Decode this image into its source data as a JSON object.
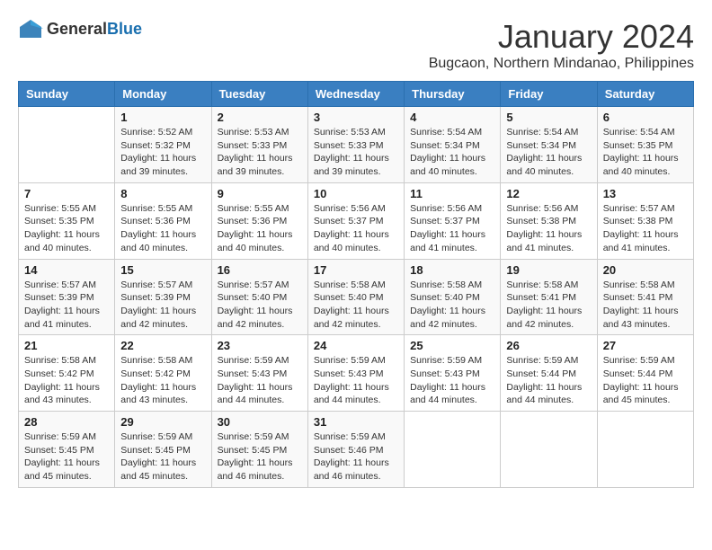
{
  "header": {
    "logo": {
      "general": "General",
      "blue": "Blue"
    },
    "title": "January 2024",
    "location": "Bugcaon, Northern Mindanao, Philippines"
  },
  "weekdays": [
    "Sunday",
    "Monday",
    "Tuesday",
    "Wednesday",
    "Thursday",
    "Friday",
    "Saturday"
  ],
  "weeks": [
    [
      {
        "day": "",
        "info": ""
      },
      {
        "day": "1",
        "info": "Sunrise: 5:52 AM\nSunset: 5:32 PM\nDaylight: 11 hours\nand 39 minutes."
      },
      {
        "day": "2",
        "info": "Sunrise: 5:53 AM\nSunset: 5:33 PM\nDaylight: 11 hours\nand 39 minutes."
      },
      {
        "day": "3",
        "info": "Sunrise: 5:53 AM\nSunset: 5:33 PM\nDaylight: 11 hours\nand 39 minutes."
      },
      {
        "day": "4",
        "info": "Sunrise: 5:54 AM\nSunset: 5:34 PM\nDaylight: 11 hours\nand 40 minutes."
      },
      {
        "day": "5",
        "info": "Sunrise: 5:54 AM\nSunset: 5:34 PM\nDaylight: 11 hours\nand 40 minutes."
      },
      {
        "day": "6",
        "info": "Sunrise: 5:54 AM\nSunset: 5:35 PM\nDaylight: 11 hours\nand 40 minutes."
      }
    ],
    [
      {
        "day": "7",
        "info": "Sunrise: 5:55 AM\nSunset: 5:35 PM\nDaylight: 11 hours\nand 40 minutes."
      },
      {
        "day": "8",
        "info": "Sunrise: 5:55 AM\nSunset: 5:36 PM\nDaylight: 11 hours\nand 40 minutes."
      },
      {
        "day": "9",
        "info": "Sunrise: 5:55 AM\nSunset: 5:36 PM\nDaylight: 11 hours\nand 40 minutes."
      },
      {
        "day": "10",
        "info": "Sunrise: 5:56 AM\nSunset: 5:37 PM\nDaylight: 11 hours\nand 40 minutes."
      },
      {
        "day": "11",
        "info": "Sunrise: 5:56 AM\nSunset: 5:37 PM\nDaylight: 11 hours\nand 41 minutes."
      },
      {
        "day": "12",
        "info": "Sunrise: 5:56 AM\nSunset: 5:38 PM\nDaylight: 11 hours\nand 41 minutes."
      },
      {
        "day": "13",
        "info": "Sunrise: 5:57 AM\nSunset: 5:38 PM\nDaylight: 11 hours\nand 41 minutes."
      }
    ],
    [
      {
        "day": "14",
        "info": "Sunrise: 5:57 AM\nSunset: 5:39 PM\nDaylight: 11 hours\nand 41 minutes."
      },
      {
        "day": "15",
        "info": "Sunrise: 5:57 AM\nSunset: 5:39 PM\nDaylight: 11 hours\nand 42 minutes."
      },
      {
        "day": "16",
        "info": "Sunrise: 5:57 AM\nSunset: 5:40 PM\nDaylight: 11 hours\nand 42 minutes."
      },
      {
        "day": "17",
        "info": "Sunrise: 5:58 AM\nSunset: 5:40 PM\nDaylight: 11 hours\nand 42 minutes."
      },
      {
        "day": "18",
        "info": "Sunrise: 5:58 AM\nSunset: 5:40 PM\nDaylight: 11 hours\nand 42 minutes."
      },
      {
        "day": "19",
        "info": "Sunrise: 5:58 AM\nSunset: 5:41 PM\nDaylight: 11 hours\nand 42 minutes."
      },
      {
        "day": "20",
        "info": "Sunrise: 5:58 AM\nSunset: 5:41 PM\nDaylight: 11 hours\nand 43 minutes."
      }
    ],
    [
      {
        "day": "21",
        "info": "Sunrise: 5:58 AM\nSunset: 5:42 PM\nDaylight: 11 hours\nand 43 minutes."
      },
      {
        "day": "22",
        "info": "Sunrise: 5:58 AM\nSunset: 5:42 PM\nDaylight: 11 hours\nand 43 minutes."
      },
      {
        "day": "23",
        "info": "Sunrise: 5:59 AM\nSunset: 5:43 PM\nDaylight: 11 hours\nand 44 minutes."
      },
      {
        "day": "24",
        "info": "Sunrise: 5:59 AM\nSunset: 5:43 PM\nDaylight: 11 hours\nand 44 minutes."
      },
      {
        "day": "25",
        "info": "Sunrise: 5:59 AM\nSunset: 5:43 PM\nDaylight: 11 hours\nand 44 minutes."
      },
      {
        "day": "26",
        "info": "Sunrise: 5:59 AM\nSunset: 5:44 PM\nDaylight: 11 hours\nand 44 minutes."
      },
      {
        "day": "27",
        "info": "Sunrise: 5:59 AM\nSunset: 5:44 PM\nDaylight: 11 hours\nand 45 minutes."
      }
    ],
    [
      {
        "day": "28",
        "info": "Sunrise: 5:59 AM\nSunset: 5:45 PM\nDaylight: 11 hours\nand 45 minutes."
      },
      {
        "day": "29",
        "info": "Sunrise: 5:59 AM\nSunset: 5:45 PM\nDaylight: 11 hours\nand 45 minutes."
      },
      {
        "day": "30",
        "info": "Sunrise: 5:59 AM\nSunset: 5:45 PM\nDaylight: 11 hours\nand 46 minutes."
      },
      {
        "day": "31",
        "info": "Sunrise: 5:59 AM\nSunset: 5:46 PM\nDaylight: 11 hours\nand 46 minutes."
      },
      {
        "day": "",
        "info": ""
      },
      {
        "day": "",
        "info": ""
      },
      {
        "day": "",
        "info": ""
      }
    ]
  ]
}
